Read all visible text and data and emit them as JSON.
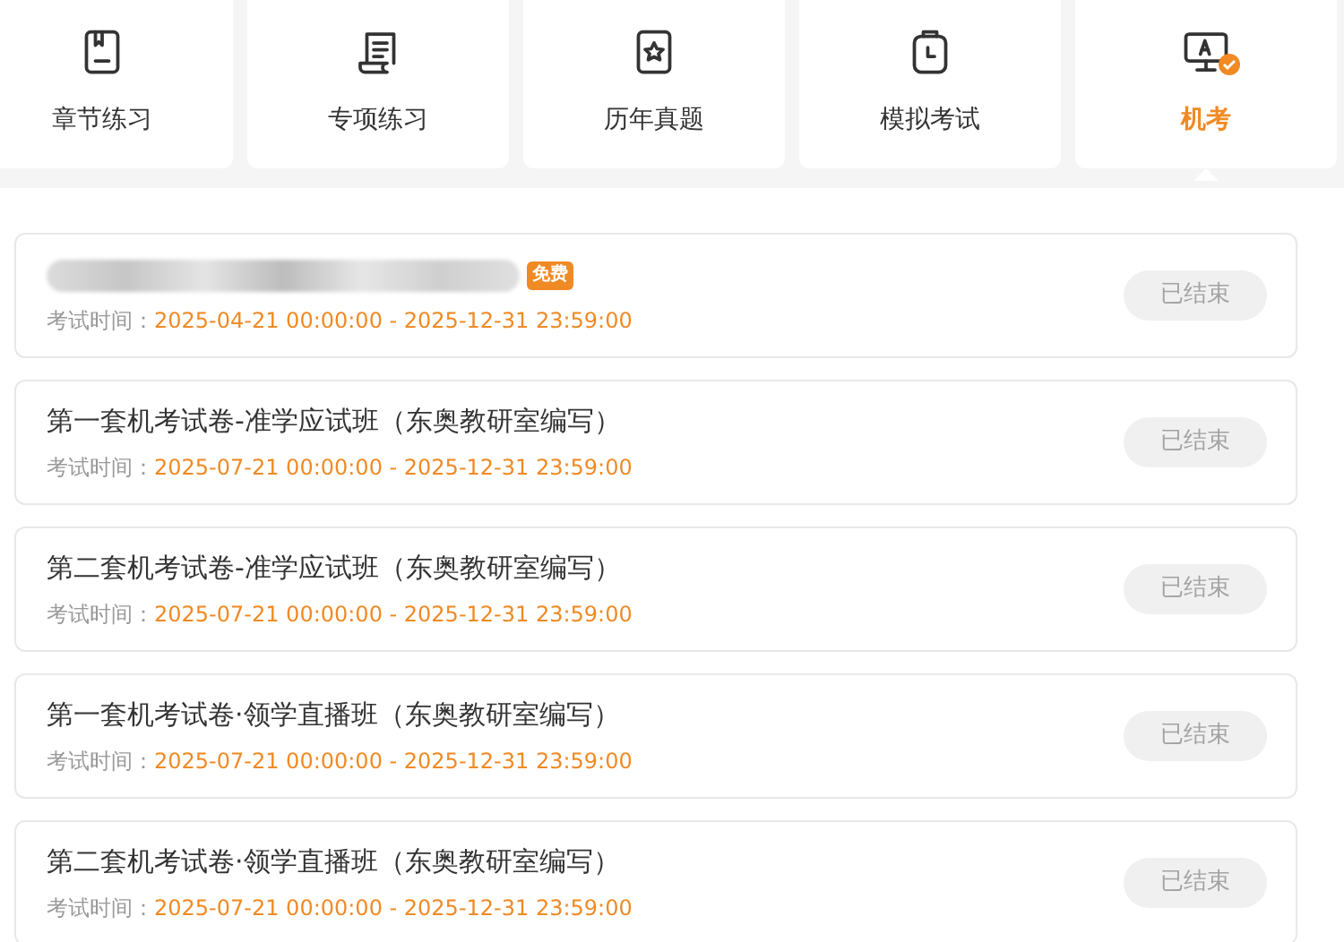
{
  "tabs": [
    {
      "label": "章节练习",
      "kind": "book",
      "selected": false
    },
    {
      "label": "专项练习",
      "kind": "scroll",
      "selected": false
    },
    {
      "label": "历年真题",
      "kind": "star",
      "selected": false
    },
    {
      "label": "模拟考试",
      "kind": "clipboard",
      "selected": false
    },
    {
      "label": "机考",
      "kind": "monitor",
      "selected": true
    }
  ],
  "exams": [
    {
      "title_redacted": true,
      "badge": "免费",
      "time_label": "考试时间：",
      "time": "2025-04-21 00:00:00 - 2025-12-31 23:59:00",
      "status": "已结束",
      "disabled": true
    },
    {
      "title": "第一套机考试卷-准学应试班（东奥教研室编写）",
      "time_label": "考试时间：",
      "time": "2025-07-21 00:00:00 - 2025-12-31 23:59:00",
      "status": "已结束",
      "disabled": true
    },
    {
      "title": "第二套机考试卷-准学应试班（东奥教研室编写）",
      "time_label": "考试时间：",
      "time": "2025-07-21 00:00:00 - 2025-12-31 23:59:00",
      "status": "已结束",
      "disabled": true
    },
    {
      "title": "第一套机考试卷·领学直播班（东奥教研室编写）",
      "time_label": "考试时间：",
      "time": "2025-07-21 00:00:00 - 2025-12-31 23:59:00",
      "status": "已结束",
      "disabled": true
    },
    {
      "title": "第二套机考试卷·领学直播班（东奥教研室编写）",
      "time_label": "考试时间：",
      "time": "2025-07-21 00:00:00 - 2025-12-31 23:59:00",
      "status": "已结束",
      "disabled": true
    }
  ]
}
